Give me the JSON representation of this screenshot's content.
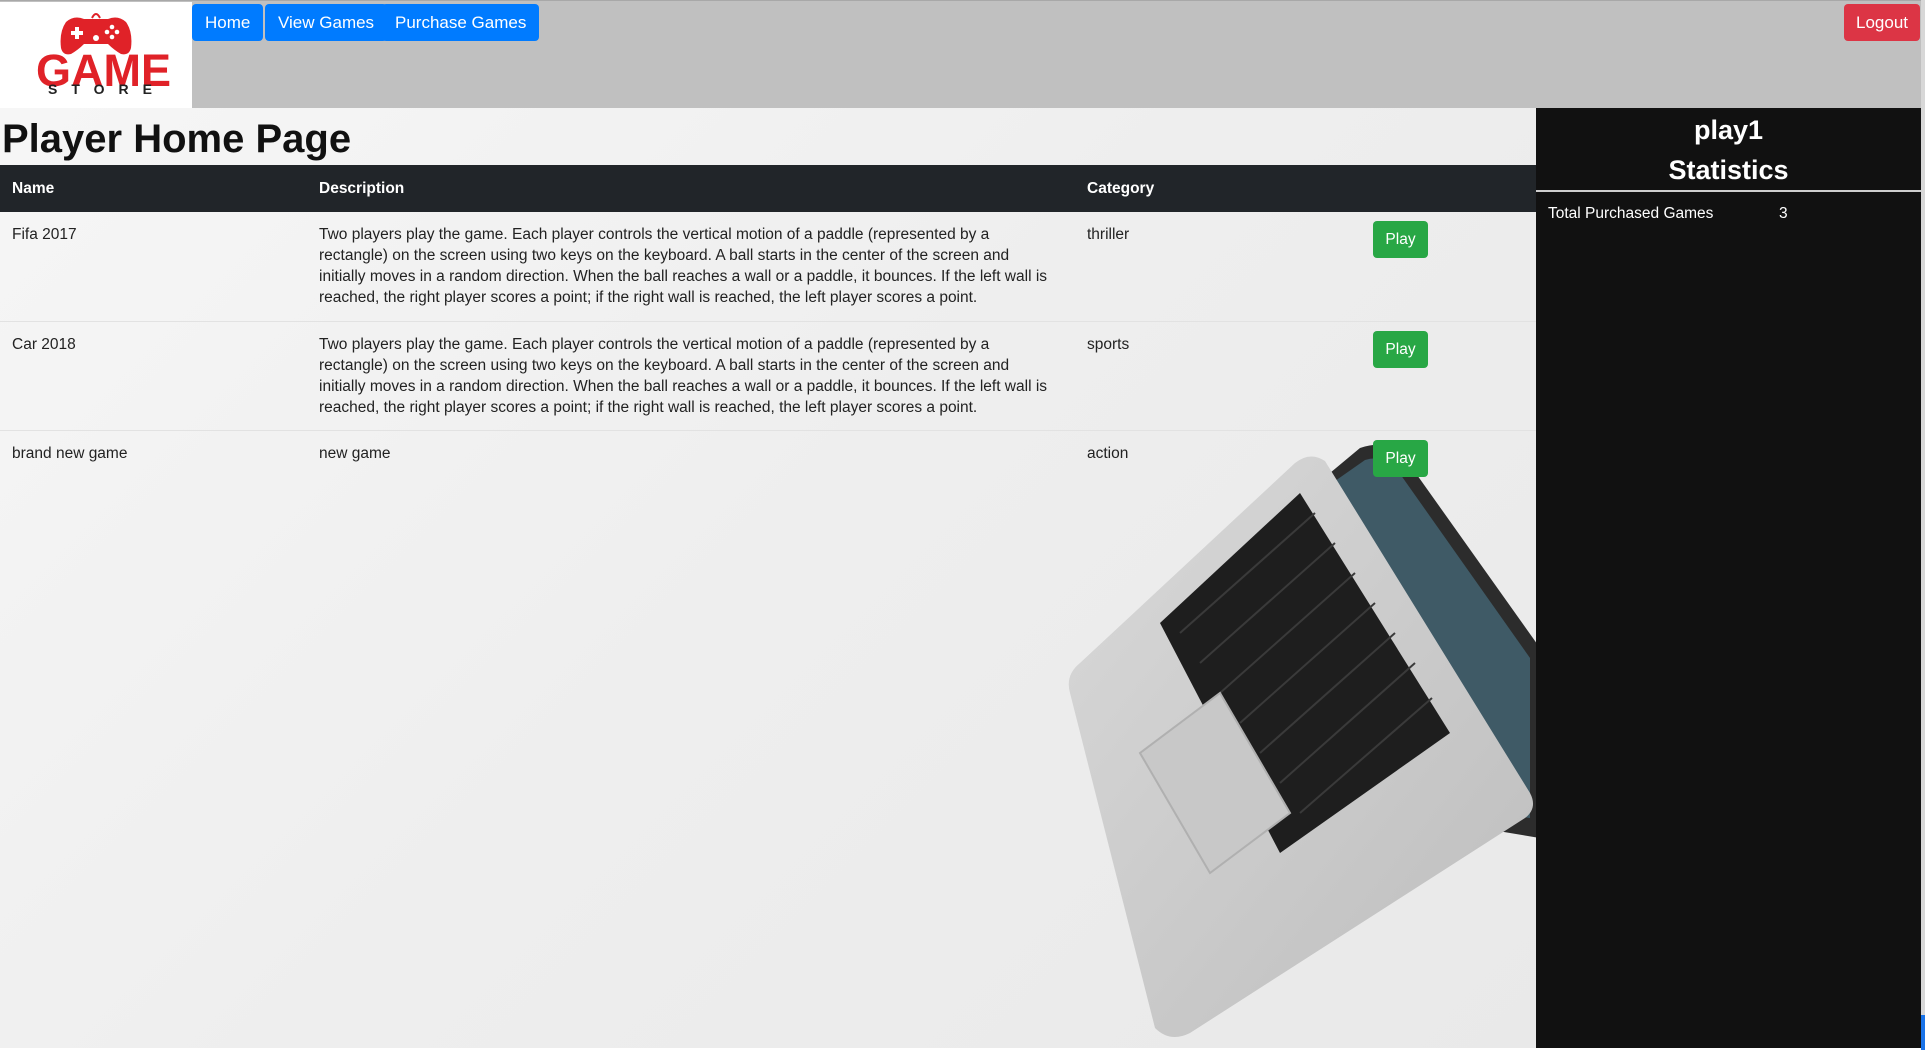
{
  "header": {
    "logo": {
      "line1": "GAME",
      "line2": "STORE"
    },
    "nav": [
      {
        "label": "Home"
      },
      {
        "label": "View Games"
      },
      {
        "label": "Purchase Games"
      }
    ],
    "logout_label": "Logout"
  },
  "main": {
    "title": "Player Home Page",
    "table": {
      "columns": [
        "Name",
        "Description",
        "Category",
        ""
      ],
      "rows": [
        {
          "name": "Fifa 2017",
          "description": "Two players play the game. Each player controls the vertical motion of a paddle (represented by a rectangle) on the screen using two keys on the keyboard. A ball starts in the center of the screen and initially moves in a random direction. When the ball reaches a wall or a paddle, it bounces. If the left wall is reached, the right player scores a point; if the right wall is reached, the left player scores a point.",
          "category": "thriller",
          "action": "Play"
        },
        {
          "name": "Car 2018",
          "description": "Two players play the game. Each player controls the vertical motion of a paddle (represented by a rectangle) on the screen using two keys on the keyboard. A ball starts in the center of the screen and initially moves in a random direction. When the ball reaches a wall or a paddle, it bounces. If the left wall is reached, the right player scores a point; if the right wall is reached, the left player scores a point.",
          "category": "sports",
          "action": "Play"
        },
        {
          "name": "brand new game",
          "description": "new game",
          "category": "action",
          "action": "Play"
        }
      ]
    }
  },
  "sidebar": {
    "username": "play1",
    "heading": "Statistics",
    "stats": [
      {
        "label": "Total Purchased Games",
        "value": "3"
      }
    ]
  },
  "colors": {
    "primary": "#007bff",
    "danger": "#dc3545",
    "success": "#28a745",
    "header_bg": "#c0c0c0",
    "table_head_bg": "#212529",
    "sidebar_bg": "#111111",
    "logo_red": "#e02228"
  }
}
